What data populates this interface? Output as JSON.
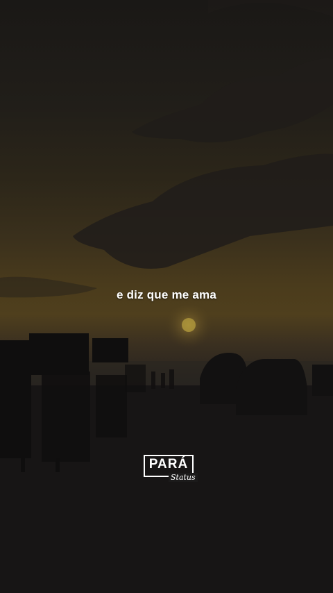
{
  "caption": "e diz que me ama",
  "logo": {
    "title": "PARÁ",
    "subtitle": "Status"
  },
  "colors": {
    "sky_dark": "#1a1816",
    "sky_glow": "#4f3f1d",
    "sun": "#a8913a",
    "ground": "#141313",
    "text": "#ffffff"
  }
}
